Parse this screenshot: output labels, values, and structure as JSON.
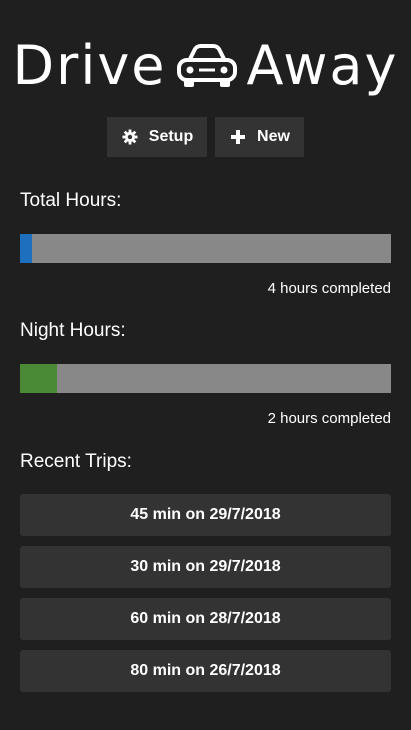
{
  "app": {
    "logo_left": "Drive",
    "logo_right": "Away"
  },
  "toolbar": {
    "setup_label": "Setup",
    "new_label": "New"
  },
  "total_hours": {
    "label": "Total Hours:",
    "caption": "4 hours completed",
    "progress_fraction": 0.033,
    "color": "#1f6fbf"
  },
  "night_hours": {
    "label": "Night Hours:",
    "caption": "2 hours completed",
    "progress_fraction": 0.1,
    "color": "#4a8a36"
  },
  "recent_trips": {
    "label": "Recent Trips:",
    "items": [
      {
        "text": "45 min on 29/7/2018"
      },
      {
        "text": "30 min on 29/7/2018"
      },
      {
        "text": "60 min on 28/7/2018"
      },
      {
        "text": "80 min on 26/7/2018"
      }
    ]
  },
  "icons": {
    "logo": "car-icon",
    "setup": "gear-icon",
    "new": "plus-icon"
  }
}
